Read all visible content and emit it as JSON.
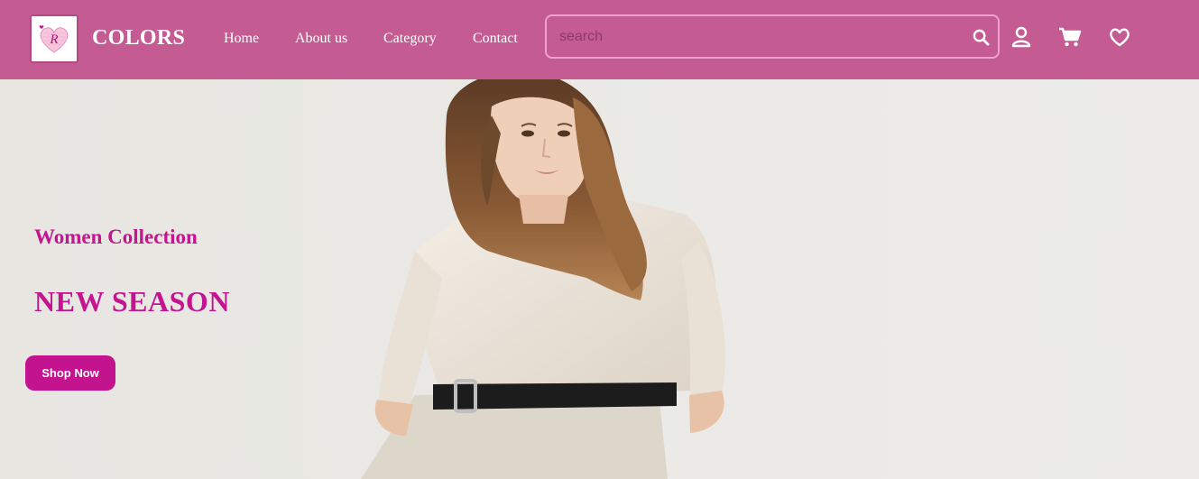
{
  "header": {
    "brand": "COLORS",
    "logo_letter": "R",
    "nav": [
      {
        "label": "Home"
      },
      {
        "label": "About us"
      },
      {
        "label": "Category"
      },
      {
        "label": "Contact"
      }
    ],
    "search": {
      "placeholder": "search"
    },
    "icons": [
      "search-icon",
      "user-icon",
      "cart-icon",
      "heart-icon"
    ]
  },
  "hero": {
    "subtitle": "Women Collection",
    "title": "NEW SEASON",
    "cta_label": "Shop Now"
  },
  "colors": {
    "navbar": "#c45b93",
    "accent": "#c41590",
    "search_border": "#f0a2cd",
    "hero_background": "#e9e8e4"
  }
}
